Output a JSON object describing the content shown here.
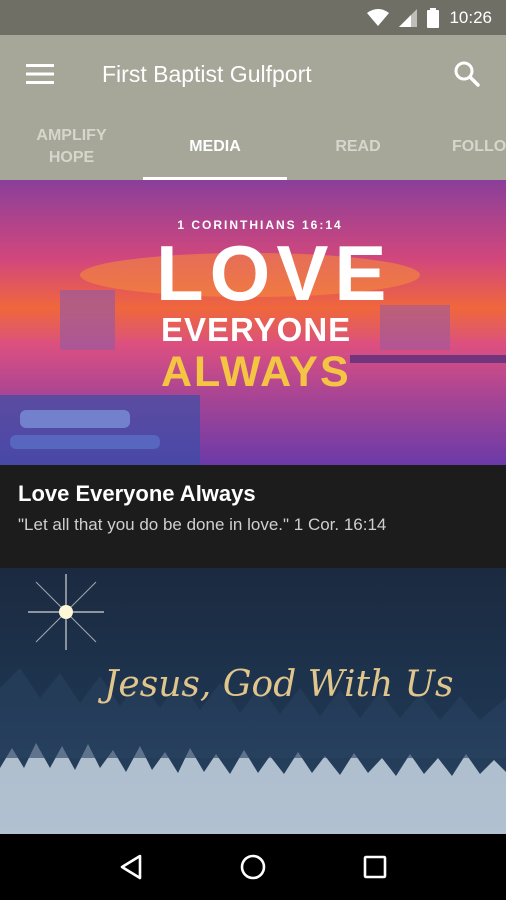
{
  "status_bar": {
    "time": "10:26"
  },
  "app_bar": {
    "title": "First Baptist Gulfport"
  },
  "tabs": [
    {
      "label": "AMPLIFY\nHOPE",
      "active": false
    },
    {
      "label": "MEDIA",
      "active": true
    },
    {
      "label": "READ",
      "active": false
    },
    {
      "label": "FOLLO",
      "active": false
    }
  ],
  "cards": [
    {
      "graphic": {
        "reference": "1 CORINTHIANS 16:14",
        "line1": "LOVE",
        "line2": "EVERYONE",
        "line3": "ALWAYS"
      },
      "title": "Love Everyone Always",
      "subtitle": "\"Let all that you do be done in love.\" 1 Cor. 16:14"
    },
    {
      "graphic": {
        "script_text": "Jesus, God With Us"
      }
    }
  ],
  "colors": {
    "status_bar": "#6f6f66",
    "app_bar": "#a6a798",
    "caption_bg": "#1c1c1c",
    "nav_bar": "#000000",
    "accent_yellow": "#f4c542"
  }
}
